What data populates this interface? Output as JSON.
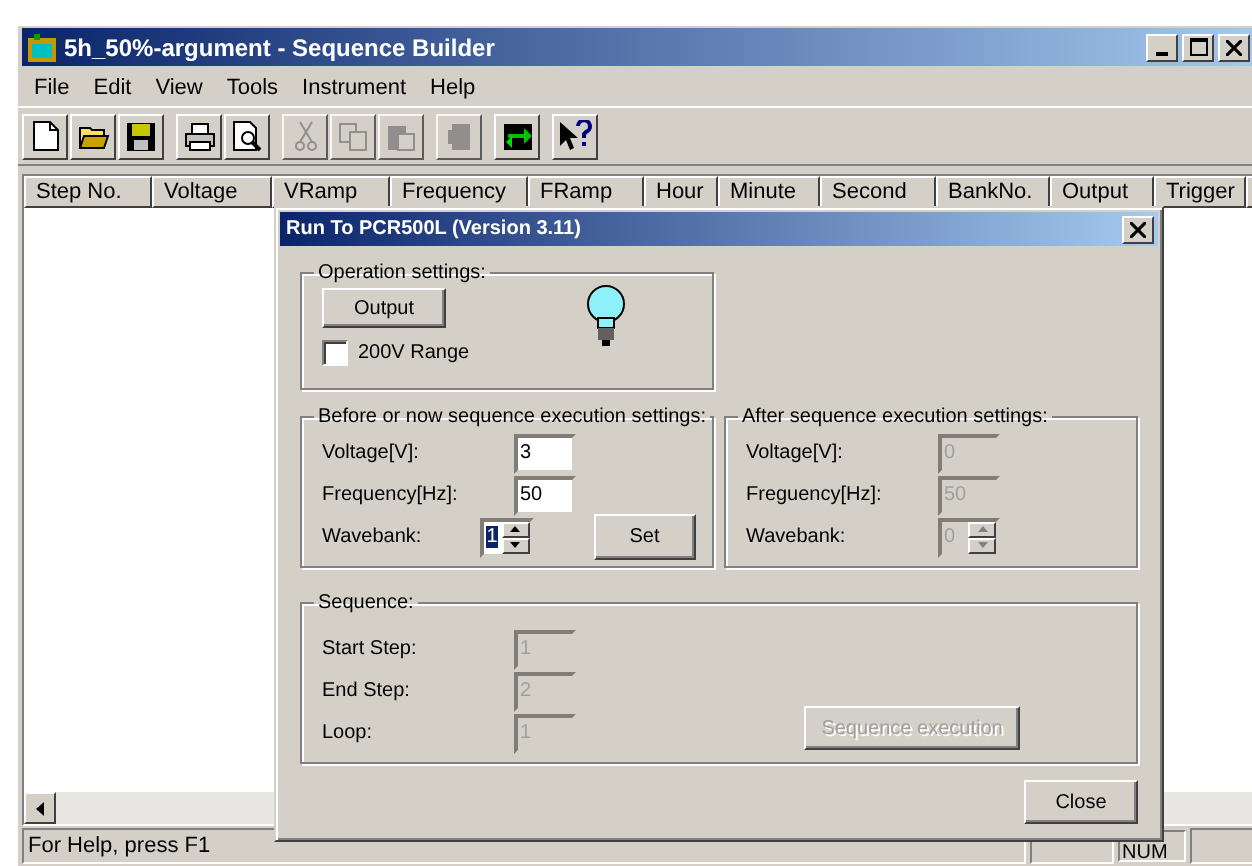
{
  "window": {
    "title": "5h_50%-argument - Sequence Builder"
  },
  "menu": [
    {
      "label": "File"
    },
    {
      "label": "Edit"
    },
    {
      "label": "View"
    },
    {
      "label": "Tools"
    },
    {
      "label": "Instrument"
    },
    {
      "label": "Help"
    }
  ],
  "toolbar": [
    [
      {
        "kind": "new",
        "disabled": false
      },
      {
        "kind": "open",
        "disabled": false
      },
      {
        "kind": "save",
        "disabled": false
      }
    ],
    [
      {
        "kind": "print",
        "disabled": false
      },
      {
        "kind": "preview",
        "disabled": false
      }
    ],
    [
      {
        "kind": "cut",
        "disabled": true
      },
      {
        "kind": "copy",
        "disabled": true
      },
      {
        "kind": "paste",
        "disabled": true
      }
    ],
    [
      {
        "kind": "run",
        "disabled": true
      }
    ],
    [
      {
        "kind": "transfer",
        "disabled": false
      }
    ],
    [
      {
        "kind": "help",
        "disabled": false
      }
    ]
  ],
  "table": {
    "columns": [
      {
        "label": "Step No."
      },
      {
        "label": "Voltage"
      },
      {
        "label": "VRamp"
      },
      {
        "label": "Frequency"
      },
      {
        "label": "FRamp"
      },
      {
        "label": "Hour"
      },
      {
        "label": "Minute"
      },
      {
        "label": "Second"
      },
      {
        "label": "BankNo."
      },
      {
        "label": "Output"
      },
      {
        "label": "Trigger"
      }
    ]
  },
  "status_bar": {
    "text": "For Help, press F1",
    "indicator": "NUM"
  },
  "dialog": {
    "title": "Run To PCR500L (Version 3.11)",
    "operation": {
      "title": "Operation settings:",
      "output_button": "Output",
      "lamp_on": true,
      "checkbox": {
        "label": "200V Range",
        "checked": false
      }
    },
    "before": {
      "title": "Before or now sequence execution settings:",
      "set_button": "Set",
      "fields": [
        {
          "kind": "text",
          "label": "Voltage[V]:",
          "value": "3",
          "disabled": false,
          "text_selected": false
        },
        {
          "kind": "text",
          "label": "Frequency[Hz]:",
          "value": "50",
          "disabled": false,
          "text_selected": false
        },
        {
          "kind": "spin",
          "label": "Wavebank:",
          "value": "1",
          "disabled": false,
          "text_selected": true
        }
      ]
    },
    "after": {
      "title": "After sequence execution settings:",
      "fields": [
        {
          "kind": "text",
          "label": "Voltage[V]:",
          "value": "0",
          "disabled": true,
          "text_selected": false
        },
        {
          "kind": "text",
          "label": "Freguency[Hz]:",
          "value": "50",
          "disabled": true,
          "text_selected": false
        },
        {
          "kind": "spin",
          "label": "Wavebank:",
          "value": "0",
          "disabled": true,
          "text_selected": false
        }
      ]
    },
    "sequence": {
      "title": "Sequence:",
      "execute_button": {
        "label": "Sequence execution",
        "disabled": true
      },
      "fields": [
        {
          "kind": "text",
          "label": "Start Step:",
          "value": "1",
          "disabled": true,
          "text_selected": false
        },
        {
          "kind": "text",
          "label": "End Step:",
          "value": "2",
          "disabled": true,
          "text_selected": false
        },
        {
          "kind": "text",
          "label": "Loop:",
          "value": "1",
          "disabled": true,
          "text_selected": false
        }
      ]
    },
    "close_button": "Close"
  }
}
